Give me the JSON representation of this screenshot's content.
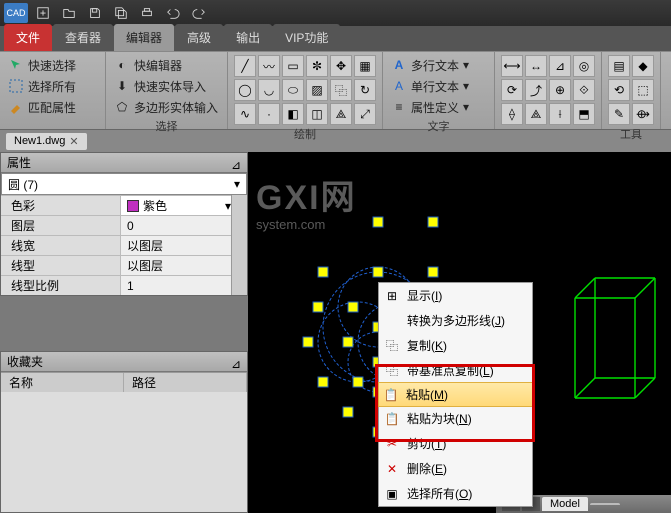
{
  "app": {
    "logo": "CAD"
  },
  "tabs": [
    "文件",
    "查看器",
    "编辑器",
    "高级",
    "输出",
    "VIP功能"
  ],
  "ribbon": {
    "g1": {
      "items": [
        "快速选择",
        "选择所有",
        "匹配属性"
      ],
      "label": ""
    },
    "g2": {
      "items": [
        "快编辑器",
        "快速实体导入",
        "多边形实体输入"
      ],
      "label": "选择"
    },
    "g3_label": "绘制",
    "g4": {
      "items": [
        "多行文本",
        "单行文本",
        "属性定义"
      ],
      "label": "文字"
    },
    "g6_label": "工具"
  },
  "doc": {
    "name": "New1.dwg"
  },
  "props": {
    "title": "属性",
    "selector": "圆 (7)",
    "rows": [
      {
        "k": "色彩",
        "v": "紫色",
        "swatch": true
      },
      {
        "k": "图层",
        "v": "0"
      },
      {
        "k": "线宽",
        "v": "以图层"
      },
      {
        "k": "线型",
        "v": "以图层"
      },
      {
        "k": "线型比例",
        "v": "1"
      }
    ]
  },
  "fav": {
    "title": "收藏夹",
    "cols": [
      "名称",
      "路径"
    ]
  },
  "wm": {
    "big": "GXI网",
    "small": "system.com"
  },
  "ctx": [
    {
      "icon": "display",
      "label": "显示",
      "key": "I"
    },
    {
      "icon": "",
      "label": "转换为多边形线",
      "key": "J"
    },
    {
      "icon": "copy",
      "label": "复制",
      "key": "K"
    },
    {
      "icon": "copy-base",
      "label": "带基准点复制",
      "key": "L"
    },
    {
      "icon": "paste",
      "label": "粘贴",
      "key": "M",
      "hi": true
    },
    {
      "icon": "paste-block",
      "label": "粘贴为块",
      "key": "N"
    },
    {
      "icon": "cut",
      "label": "剪切",
      "key": "T"
    },
    {
      "icon": "delete",
      "label": "删除",
      "key": "E"
    },
    {
      "icon": "select-all",
      "label": "选择所有",
      "key": "O"
    }
  ],
  "status": {
    "model": "Model"
  }
}
